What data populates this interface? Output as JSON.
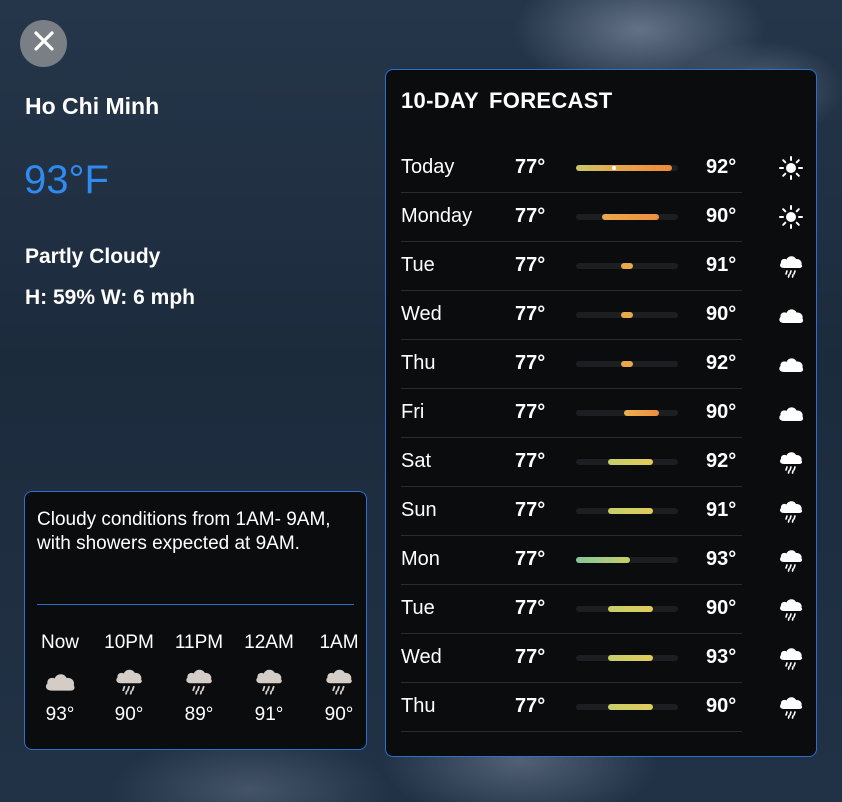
{
  "location": {
    "city": "Ho Chi Minh",
    "temperature": "93°F",
    "condition": "Partly Cloudy",
    "humidity_wind": "H: 59%  W: 6 mph"
  },
  "hourly": {
    "summary": "Cloudy conditions from 1AM- 9AM, with showers expected at 9AM.",
    "items": [
      {
        "label": "Now",
        "icon": "cloud-icon",
        "temp": "93°"
      },
      {
        "label": "10PM",
        "icon": "cloud-rain-icon",
        "temp": "90°"
      },
      {
        "label": "11PM",
        "icon": "cloud-rain-icon",
        "temp": "89°"
      },
      {
        "label": "12AM",
        "icon": "cloud-rain-icon",
        "temp": "91°"
      },
      {
        "label": "1AM",
        "icon": "cloud-rain-icon",
        "temp": "90°"
      }
    ]
  },
  "forecast": {
    "title": "10-DAY  FORECAST",
    "bar_min": 77,
    "bar_max": 93,
    "days": [
      {
        "day": "Today",
        "low": "77°",
        "high": "92°",
        "low_val": 77,
        "high_val": 92,
        "icon": "sun-icon",
        "bar_color": "linear-gradient(90deg,#c9c76a,#e9a34a,#ef8a3a)",
        "current": 83
      },
      {
        "day": "Monday",
        "low": "77°",
        "high": "90°",
        "low_val": 81,
        "high_val": 90,
        "icon": "sun-icon",
        "bar_color": "linear-gradient(90deg,#e9a84a,#ef8e3f)"
      },
      {
        "day": "Tue",
        "low": "77°",
        "high": "91°",
        "low_val": 84,
        "high_val": 86,
        "icon": "cloud-rain-icon",
        "bar_color": "#e9a84a"
      },
      {
        "day": "Wed",
        "low": "77°",
        "high": "90°",
        "low_val": 84,
        "high_val": 86,
        "icon": "cloud-icon",
        "bar_color": "#e9a84a"
      },
      {
        "day": "Thu",
        "low": "77°",
        "high": "92°",
        "low_val": 84,
        "high_val": 86,
        "icon": "cloud-icon",
        "bar_color": "#e9a84a"
      },
      {
        "day": "Fri",
        "low": "77°",
        "high": "90°",
        "low_val": 84.5,
        "high_val": 90,
        "icon": "cloud-icon",
        "bar_color": "linear-gradient(90deg,#eeb04c,#ef8e3f)"
      },
      {
        "day": "Sat",
        "low": "77°",
        "high": "92°",
        "low_val": 82,
        "high_val": 89,
        "icon": "cloud-rain-icon",
        "bar_color": "linear-gradient(90deg,#c6cf6a,#e1cb5c)"
      },
      {
        "day": "Sun",
        "low": "77°",
        "high": "91°",
        "low_val": 82,
        "high_val": 89,
        "icon": "cloud-rain-icon",
        "bar_color": "linear-gradient(90deg,#c6cf6a,#e1cb5c)"
      },
      {
        "day": "Mon",
        "low": "77°",
        "high": "93°",
        "low_val": 77,
        "high_val": 85.5,
        "icon": "cloud-rain-icon",
        "bar_color": "linear-gradient(90deg,#86c79a,#c6cf6a)"
      },
      {
        "day": "Tue",
        "low": "77°",
        "high": "90°",
        "low_val": 82,
        "high_val": 89,
        "icon": "cloud-rain-icon",
        "bar_color": "linear-gradient(90deg,#c6cf6a,#e1cb5c)"
      },
      {
        "day": "Wed",
        "low": "77°",
        "high": "93°",
        "low_val": 82,
        "high_val": 89,
        "icon": "cloud-rain-icon",
        "bar_color": "linear-gradient(90deg,#c6cf6a,#e1cb5c)"
      },
      {
        "day": "Thu",
        "low": "77°",
        "high": "90°",
        "low_val": 82,
        "high_val": 89,
        "icon": "cloud-rain-icon",
        "bar_color": "linear-gradient(90deg,#c6cf6a,#e1cb5c)"
      }
    ]
  },
  "colors": {
    "accent": "#2e8bf0",
    "border": "#2c6fd1"
  }
}
